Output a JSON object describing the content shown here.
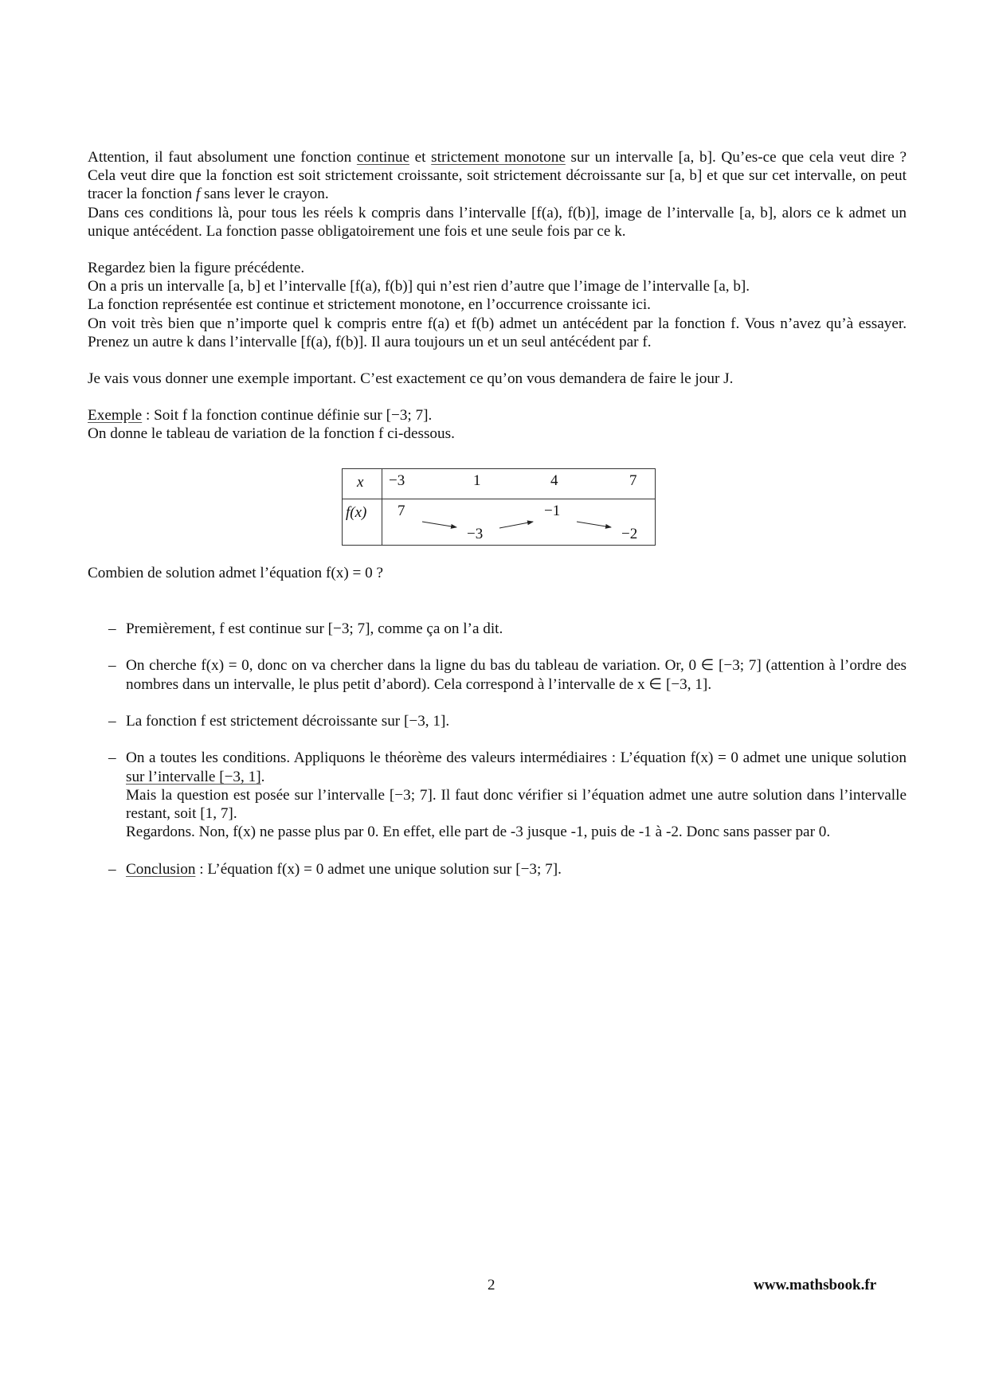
{
  "intro": {
    "p1_l1_a": "Attention, il faut absolument une fonction ",
    "p1_u1": "continue",
    "p1_l1_b": " et ",
    "p1_u2": "strictement monotone",
    "p1_l1_c": " sur un intervalle [a, b]. Qu’es-ce que cela veut dire ? Cela veut dire que la fonction est soit strictement croissante, soit strictement décroissante sur [a, b] et que sur cet intervalle, on peut tracer la fonction ",
    "p1_f": "f",
    "p1_l1_d": " sans lever le crayon.",
    "p2": "Dans ces conditions là, pour tous les réels k compris dans l’intervalle [f(a), f(b)], image de l’intervalle [a, b], alors ce k admet un unique antécédent. La fonction passe obligatoirement une fois et une seule fois par ce k."
  },
  "figure_note": {
    "l1": "Regardez bien la figure précédente.",
    "l2": "On a pris un intervalle [a, b] et l’intervalle [f(a), f(b)] qui n’est rien d’autre que l’image de l’intervalle [a, b].",
    "l3": "La fonction représentée est continue et strictement monotone, en l’occurrence croissante ici.",
    "l4": "On voit très bien que n’importe quel k compris entre f(a) et f(b) admet un antécédent par la fonction f. Vous n’avez qu’à essayer. Prenez un autre k dans l’intervalle [f(a), f(b)]. Il aura toujours un et un seul antécédent par f."
  },
  "example_intro": "Je vais vous donner une exemple important. C’est exactement ce qu’on vous demandera de faire le jour J.",
  "example": {
    "label": "Exemple",
    "l1_rest": " : Soit f la fonction continue définie sur [−3; 7].",
    "l2": "On donne le tableau de variation de la fonction f ci-dessous."
  },
  "variation_table": {
    "x_label": "x",
    "fx_label": "f(x)",
    "x_values": [
      "−3",
      "1",
      "4",
      "7"
    ],
    "f_values": [
      "7",
      "−3",
      "−1",
      "−2"
    ],
    "f_levels": [
      "high",
      "low",
      "high",
      "low"
    ],
    "arrows": [
      "decreasing",
      "increasing",
      "decreasing"
    ]
  },
  "question": "Combien de solution admet l’équation f(x) = 0 ?",
  "steps": [
    {
      "text": "Premièrement, f est continue sur [−3; 7], comme ça on l’a dit."
    },
    {
      "text": "On cherche f(x) = 0, donc on va chercher dans la ligne du bas du tableau de variation. Or, 0 ∈ [−3; 7] (attention à l’ordre des nombres dans un intervalle, le plus petit d’abord). Cela correspond à l’intervalle de x ∈ [−3, 1]."
    },
    {
      "text": "La fonction f est strictement décroissante sur [−3, 1]."
    },
    {
      "text_a": "On a toutes les conditions. Appliquons le théorème des valeurs intermédiaires : L’équation f(x) = 0 admet une unique solution ",
      "underlined": "sur l’intervalle [−3, 1]",
      "text_b": ".",
      "text_c": "Mais la question est posée sur l’intervalle [−3; 7]. Il faut donc vérifier si l’équation admet une autre solution dans l’intervalle restant, soit [1, 7].",
      "text_d": "Regardons. Non, f(x) ne passe plus par 0. En effet, elle part de -3 jusque -1, puis de -1 à -2. Donc sans passer par 0."
    },
    {
      "label": "Conclusion",
      "text": " : L’équation f(x) = 0 admet une unique solution sur [−3; 7]."
    }
  ],
  "list_dash": "–",
  "footer": {
    "page_number": "2",
    "website": "www.mathsbook.fr"
  }
}
